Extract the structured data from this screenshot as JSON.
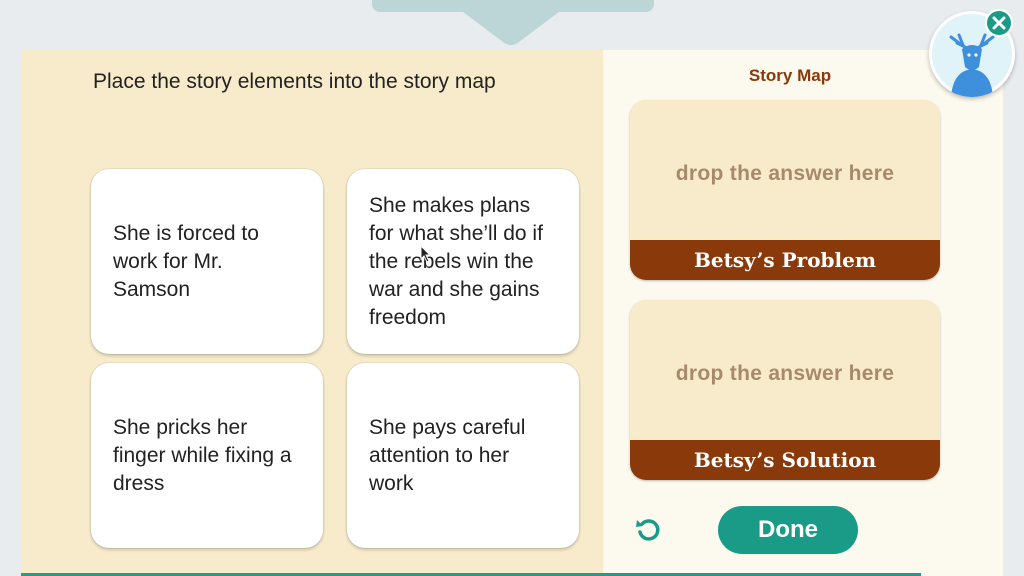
{
  "instruction": "Place the story elements into the story map",
  "cards": [
    {
      "text": "She is forced to work for Mr. Samson"
    },
    {
      "text": "She makes plans for what she’ll do if the rebels win the war and she gains freedom"
    },
    {
      "text": "She pricks her finger while fixing a dress"
    },
    {
      "text": "She pays careful attention to her work"
    }
  ],
  "story_map": {
    "title": "Story Map",
    "zones": [
      {
        "placeholder": "drop the answer here",
        "label": "Betsy’s Problem"
      },
      {
        "placeholder": "drop the answer here",
        "label": "Betsy’s Solution"
      }
    ]
  },
  "buttons": {
    "done": "Done",
    "reset_icon": "reset-icon",
    "close_icon": "close-icon"
  },
  "colors": {
    "left_panel": "#f8ebcb",
    "right_panel": "#fcf9ee",
    "accent_teal": "#1a9b88",
    "label_brown": "#8a3a0a",
    "drop_text": "#a8896b"
  }
}
